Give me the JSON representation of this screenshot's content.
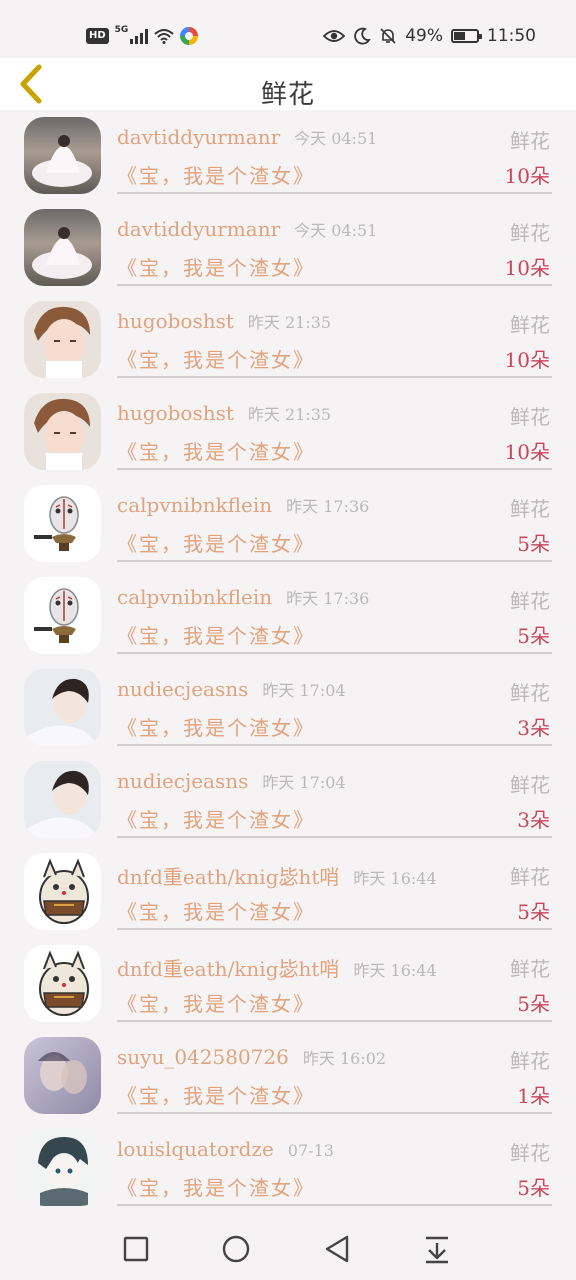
{
  "status_bar": {
    "hd_label": "HD",
    "network_label": "5G",
    "battery_percent": "49%",
    "battery_level": 0.49,
    "time": "11:50"
  },
  "header": {
    "title": "鲜花",
    "back_icon": "chevron-left-icon",
    "back_color": "#c9a400"
  },
  "colors": {
    "name": "#e0a37e",
    "count": "#c8465a",
    "muted": "#b9b9b9"
  },
  "items": [
    {
      "username": "davtiddyurmanr",
      "time": "今天 04:51",
      "gift": "鲜花",
      "subject": "《宝，我是个渣女》",
      "count": "10朵",
      "avatar": "avatar-wedding-dress"
    },
    {
      "username": "davtiddyurmanr",
      "time": "今天 04:51",
      "gift": "鲜花",
      "subject": "《宝，我是个渣女》",
      "count": "10朵",
      "avatar": "avatar-wedding-dress"
    },
    {
      "username": "hugoboshst",
      "time": "昨天 21:35",
      "gift": "鲜花",
      "subject": "《宝，我是个渣女》",
      "count": "10朵",
      "avatar": "avatar-boy-portrait"
    },
    {
      "username": "hugoboshst",
      "time": "昨天 21:35",
      "gift": "鲜花",
      "subject": "《宝，我是个渣女》",
      "count": "10朵",
      "avatar": "avatar-boy-portrait"
    },
    {
      "username": "calpvnibnkflein",
      "time": "昨天 17:36",
      "gift": "鲜花",
      "subject": "《宝，我是个渣女》",
      "count": "5朵",
      "avatar": "avatar-hockey-mask"
    },
    {
      "username": "calpvnibnkflein",
      "time": "昨天 17:36",
      "gift": "鲜花",
      "subject": "《宝，我是个渣女》",
      "count": "5朵",
      "avatar": "avatar-hockey-mask"
    },
    {
      "username": "nudiecjeasns",
      "time": "昨天 17:04",
      "gift": "鲜花",
      "subject": "《宝，我是个渣女》",
      "count": "3朵",
      "avatar": "avatar-dark-hair-boy"
    },
    {
      "username": "nudiecjeasns",
      "time": "昨天 17:04",
      "gift": "鲜花",
      "subject": "《宝，我是个渣女》",
      "count": "3朵",
      "avatar": "avatar-dark-hair-boy"
    },
    {
      "username": "dnfd重eath/knig毖ht哨",
      "time": "昨天 16:44",
      "gift": "鲜花",
      "subject": "《宝，我是个渣女》",
      "count": "5朵",
      "avatar": "avatar-cartoon-cat"
    },
    {
      "username": "dnfd重eath/knig毖ht哨",
      "time": "昨天 16:44",
      "gift": "鲜花",
      "subject": "《宝，我是个渣女》",
      "count": "5朵",
      "avatar": "avatar-cartoon-cat"
    },
    {
      "username": "suyu_042580726",
      "time": "昨天 16:02",
      "gift": "鲜花",
      "subject": "《宝，我是个渣女》",
      "count": "1朵",
      "avatar": "avatar-couple-blur"
    },
    {
      "username": "louislquatordze",
      "time": "07-13",
      "gift": "鲜花",
      "subject": "《宝，我是个渣女》",
      "count": "5朵",
      "avatar": "avatar-anime-sketch"
    }
  ],
  "nav_bar": {
    "recent_icon": "square-icon",
    "home_icon": "circle-icon",
    "back_icon": "triangle-back-icon",
    "menu_icon": "pull-down-icon"
  }
}
